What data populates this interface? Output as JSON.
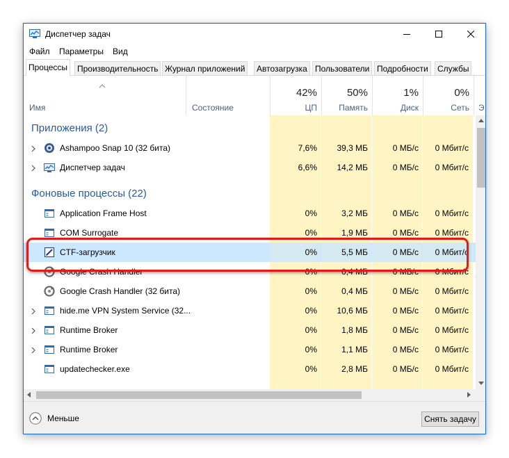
{
  "window": {
    "title": "Диспетчер задач"
  },
  "menu": {
    "items": [
      "Файл",
      "Параметры",
      "Вид"
    ]
  },
  "tabs": [
    "Процессы",
    "Производительность",
    "Журнал приложений",
    "Автозагрузка",
    "Пользователи",
    "Подробности",
    "Службы"
  ],
  "active_tab": "Процессы",
  "columns": {
    "name": "Имя",
    "status": "Состояние",
    "cpu": {
      "percent": "42%",
      "label": "ЦП"
    },
    "memory": {
      "percent": "50%",
      "label": "Память"
    },
    "disk": {
      "percent": "1%",
      "label": "Диск"
    },
    "network": {
      "percent": "0%",
      "label": "Сеть"
    },
    "extra": "Э"
  },
  "groups": [
    {
      "title": "Приложения (2)"
    },
    {
      "title": "Фоновые процессы (22)"
    }
  ],
  "processes": [
    {
      "name": "Ashampoo Snap 10 (32 бита)",
      "cpu": "7,6%",
      "memory": "39,3 МБ",
      "disk": "0 МБ/с",
      "network": "0 Мбит/с",
      "icon": "ashampoo-icon",
      "expandable": true
    },
    {
      "name": "Диспетчер задач",
      "cpu": "6,6%",
      "memory": "14,2 МБ",
      "disk": "0 МБ/с",
      "network": "0 Мбит/с",
      "icon": "taskmgr-icon",
      "expandable": true
    },
    {
      "name": "Application Frame Host",
      "cpu": "0%",
      "memory": "3,2 МБ",
      "disk": "0 МБ/с",
      "network": "0 Мбит/с",
      "icon": "window-app-icon",
      "expandable": false
    },
    {
      "name": "COM Surrogate",
      "cpu": "0%",
      "memory": "1,9 МБ",
      "disk": "0 МБ/с",
      "network": "0 Мбит/с",
      "icon": "window-app-icon",
      "expandable": false
    },
    {
      "name": "CTF-загрузчик",
      "cpu": "0%",
      "memory": "5,5 МБ",
      "disk": "0 МБ/с",
      "network": "0 Мбит/с",
      "icon": "ctf-loader-icon",
      "expandable": false,
      "selected": true
    },
    {
      "name": "Google Crash Handler",
      "cpu": "0%",
      "memory": "0,4 МБ",
      "disk": "0 МБ/с",
      "network": "0 Мбит/с",
      "icon": "google-update-icon",
      "expandable": false
    },
    {
      "name": "Google Crash Handler (32 бита)",
      "cpu": "0%",
      "memory": "0,4 МБ",
      "disk": "0 МБ/с",
      "network": "0 Мбит/с",
      "icon": "google-update-icon",
      "expandable": false
    },
    {
      "name": "hide.me VPN System Service (32...",
      "cpu": "0%",
      "memory": "10,6 МБ",
      "disk": "0 МБ/с",
      "network": "0 Мбит/с",
      "icon": "window-app-icon",
      "expandable": true
    },
    {
      "name": "Runtime Broker",
      "cpu": "0%",
      "memory": "1,8 МБ",
      "disk": "0 МБ/с",
      "network": "0 Мбит/с",
      "icon": "window-app-icon",
      "expandable": true
    },
    {
      "name": "Runtime Broker",
      "cpu": "0%",
      "memory": "1,1 МБ",
      "disk": "0 МБ/с",
      "network": "0 Мбит/с",
      "icon": "window-app-icon",
      "expandable": true
    },
    {
      "name": "updatechecker.exe",
      "cpu": "0%",
      "memory": "2,8 МБ",
      "disk": "0 МБ/с",
      "network": "0 Мбит/с",
      "icon": "window-app-icon",
      "expandable": false
    }
  ],
  "footer": {
    "less_label": "Меньше",
    "end_task_label": "Снять задачу"
  },
  "colors": {
    "highlight": "#e41a1a",
    "selected_row": "#cce8ff",
    "heat_column": "#fff4c4",
    "group_title": "#2a5a9e",
    "header_label": "#4d6082"
  }
}
